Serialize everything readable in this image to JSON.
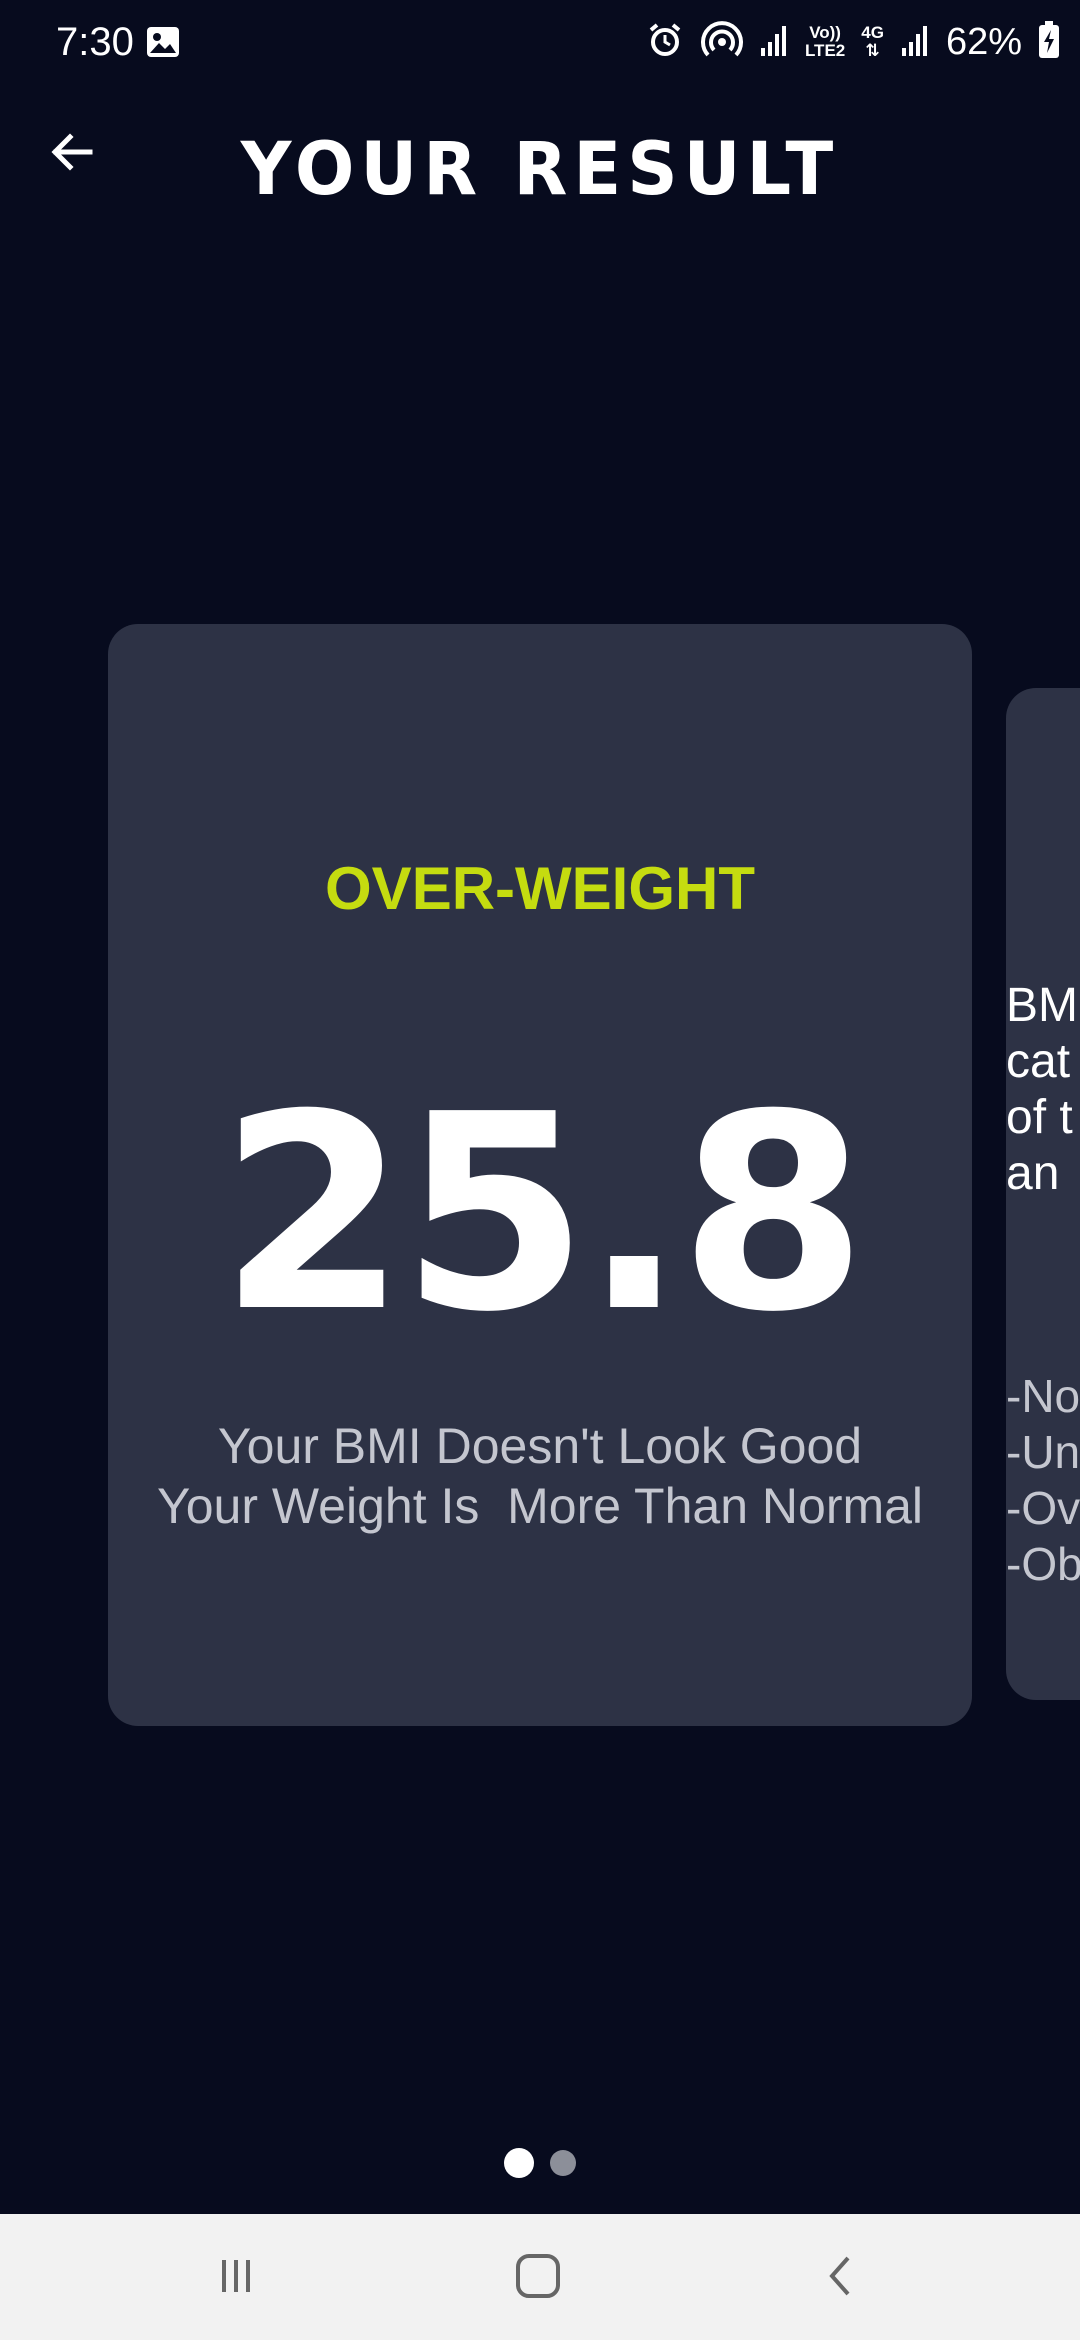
{
  "status_bar": {
    "time": "7:30",
    "network_label_top": "Vo))",
    "network_label_bottom": "LTE2",
    "network_type": "4G",
    "battery_percent": "62%",
    "icons": [
      "gallery-icon",
      "alarm-icon",
      "hotspot-icon",
      "signal-icon",
      "signal-icon",
      "battery-charging-icon"
    ]
  },
  "header": {
    "title": "YOUR RESULT",
    "back_icon": "arrow-left-icon"
  },
  "result": {
    "category": "OVER-WEIGHT",
    "bmi": "25.8",
    "message_line1": "Your BMI Doesn't Look Good",
    "message_line2": "Your Weight Is  More Than Normal"
  },
  "info_card": {
    "text": "BM\ncat\nof t\nan",
    "list": "-No\n-Un\n-Ove\n-Ob"
  },
  "pager": {
    "pages": 2,
    "active_page": 1
  },
  "navigation": {
    "icons": [
      "recent-apps-icon",
      "home-icon",
      "back-icon"
    ]
  },
  "colors": {
    "background": "#070b1e",
    "card": "#2d3245",
    "category": "#c5dc10",
    "text_secondary": "#c4c6cf"
  }
}
